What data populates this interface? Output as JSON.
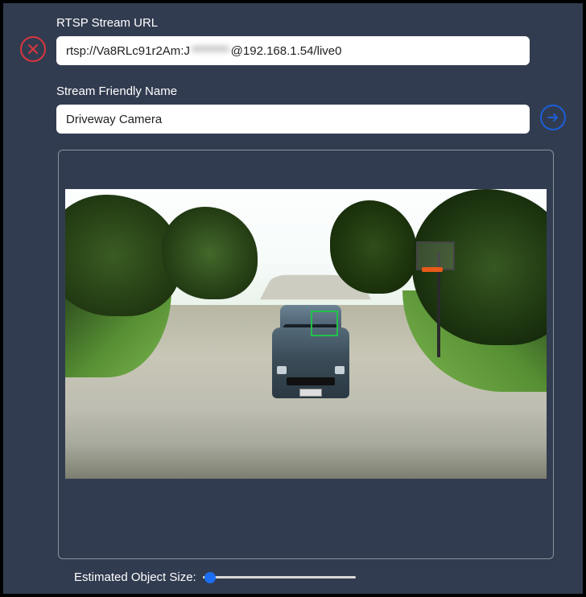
{
  "form": {
    "url_label": "RTSP Stream URL",
    "url_value_prefix": "rtsp://Va8RLc91r2Am:J",
    "url_value_hidden": "********",
    "url_value_suffix": "@192.168.1.54/live0",
    "name_label": "Stream Friendly Name",
    "name_value": "Driveway Camera"
  },
  "slider": {
    "label": "Estimated Object Size:",
    "value_percent": 4
  },
  "icons": {
    "close": "close",
    "next": "arrow-right"
  },
  "colors": {
    "panel_bg": "#323c50",
    "close": "#d9363e",
    "next": "#1b5fd9",
    "slider_thumb": "#1b6ef3",
    "detect_box": "#21c24a"
  },
  "preview": {
    "description": "Driveway camera view with vehicle and detection box"
  }
}
